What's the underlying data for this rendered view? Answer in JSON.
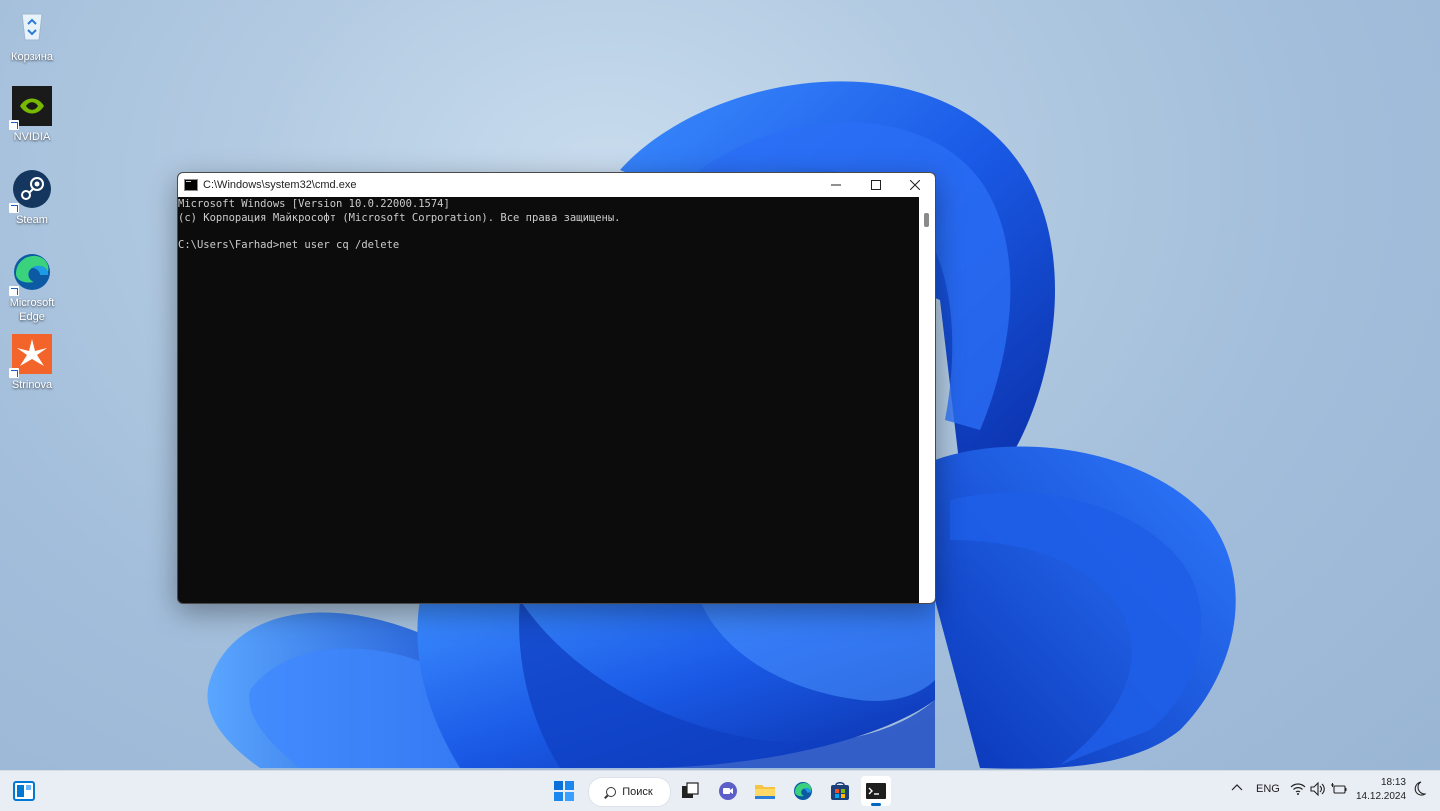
{
  "desktop": {
    "icons": [
      {
        "label": "Корзина",
        "icon": "recycle-bin-icon"
      },
      {
        "label": "NVIDIA",
        "icon": "nvidia-icon"
      },
      {
        "label": "Steam",
        "icon": "steam-icon"
      },
      {
        "label": "Microsoft Edge",
        "icon": "edge-icon"
      },
      {
        "label": "Strinova",
        "icon": "strinova-icon"
      }
    ]
  },
  "cmd_window": {
    "title": "C:\\Windows\\system32\\cmd.exe",
    "lines": [
      "Microsoft Windows [Version 10.0.22000.1574]",
      "(c) Корпорация Майкрософт (Microsoft Corporation). Все права защищены.",
      "",
      "C:\\Users\\Farhad>net user cq /delete"
    ]
  },
  "taskbar": {
    "search_label": "Поиск",
    "apps": [
      "start-icon",
      "task-view-icon",
      "chat-icon",
      "file-explorer-icon",
      "edge-icon",
      "store-icon",
      "terminal-icon"
    ],
    "tray": {
      "lang": "ENG",
      "time": "18:13",
      "date": "14.12.2024"
    }
  },
  "colors": {
    "terminal_bg": "#0c0c0c",
    "terminal_fg": "#cccccc",
    "accent": "#0067c0",
    "bloom": "#1a5ae6"
  }
}
